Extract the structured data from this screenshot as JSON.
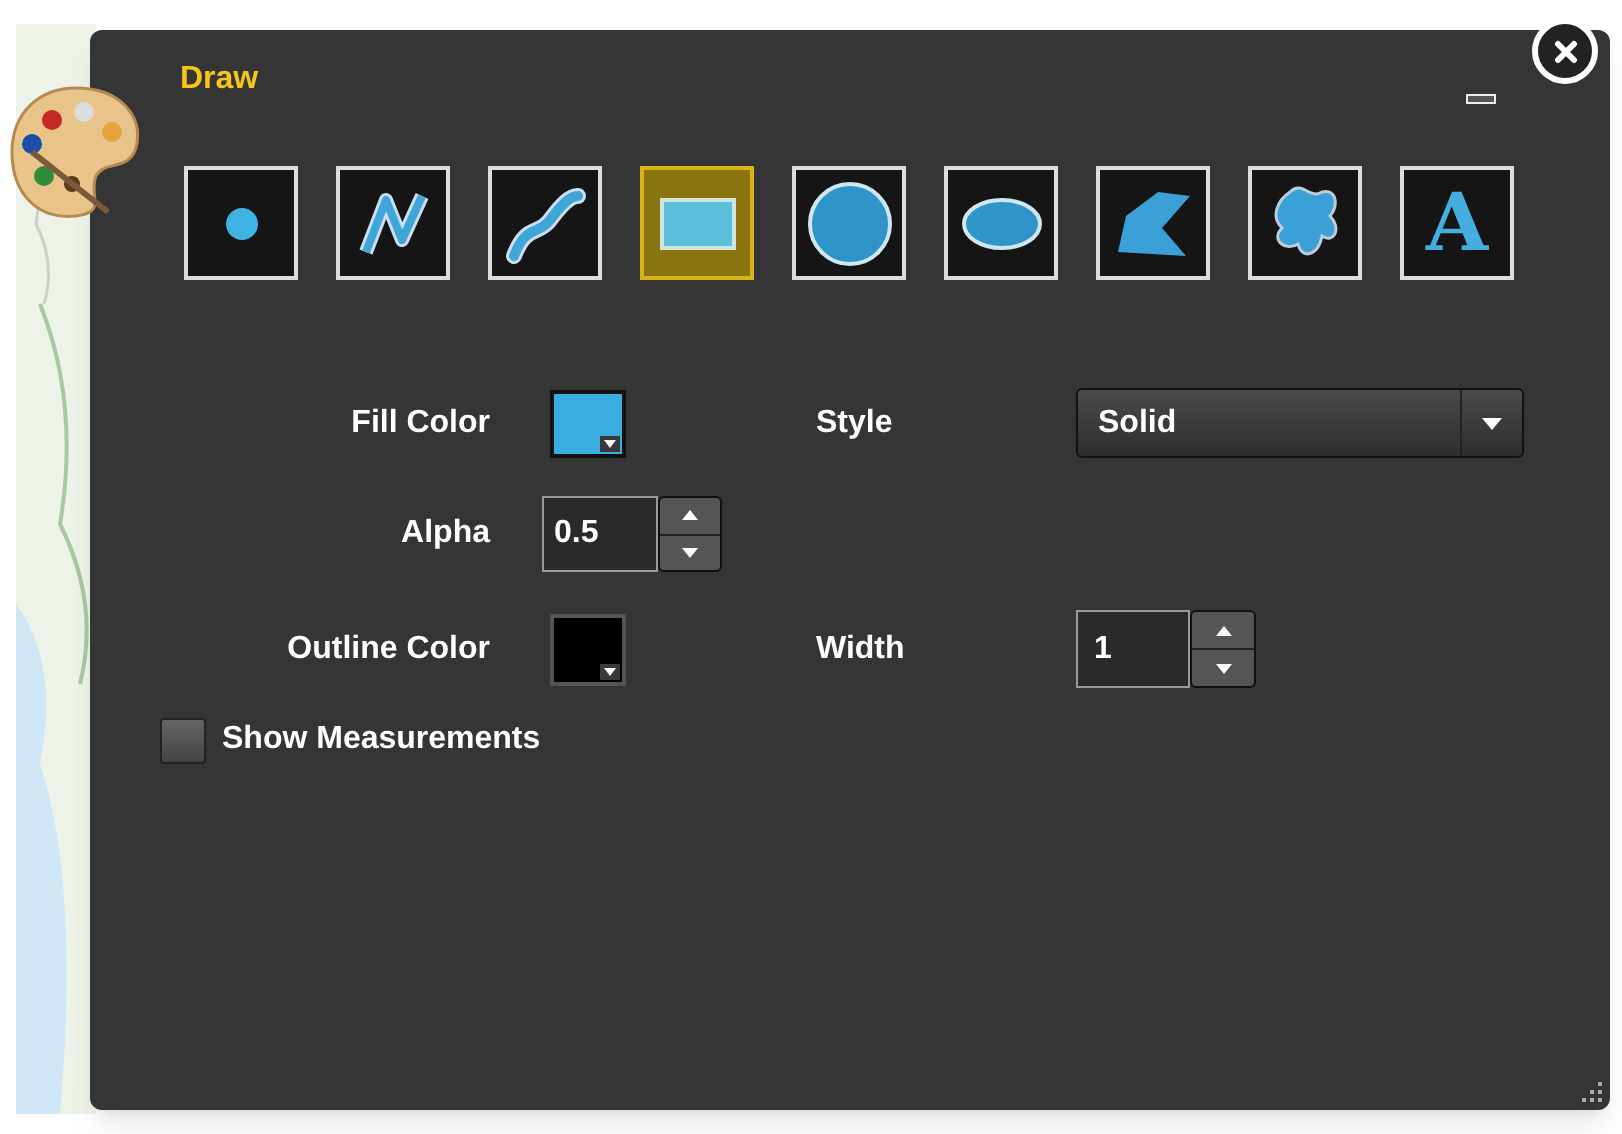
{
  "window": {
    "title": "Draw"
  },
  "tools": [
    {
      "kind": "point",
      "selected": false
    },
    {
      "kind": "polyline",
      "selected": false
    },
    {
      "kind": "freehand",
      "selected": false
    },
    {
      "kind": "rectangle",
      "selected": true
    },
    {
      "kind": "circle",
      "selected": false
    },
    {
      "kind": "ellipse",
      "selected": false
    },
    {
      "kind": "polygon",
      "selected": false
    },
    {
      "kind": "freehand_polygon",
      "selected": false
    },
    {
      "kind": "text",
      "label": "A",
      "selected": false
    }
  ],
  "fill_color": {
    "label": "Fill Color",
    "color": "#3aaee3"
  },
  "style": {
    "label": "Style",
    "value": "Solid"
  },
  "alpha": {
    "label": "Alpha",
    "value": "0.5"
  },
  "outline_color": {
    "label": "Outline Color",
    "color": "#000000"
  },
  "width": {
    "label": "Width",
    "value": "1"
  },
  "show_measurements": {
    "label": "Show Measurements",
    "checked": false
  }
}
